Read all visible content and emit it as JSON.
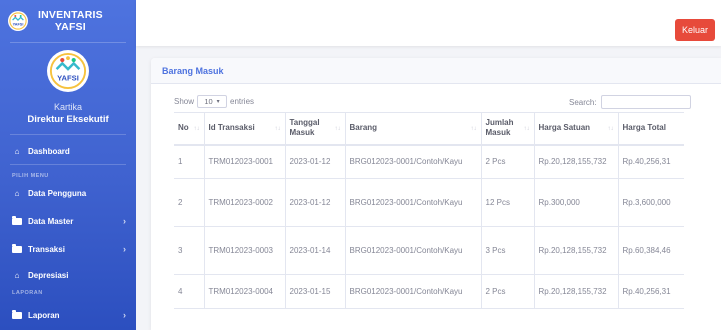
{
  "brand": {
    "line1": "INVENTARIS",
    "line2": "YAFSI",
    "logo_text": "YAFSI"
  },
  "profile": {
    "logo_text": "YAFSI",
    "name": "Kartika",
    "role": "Direktur Eksekutif"
  },
  "nav": {
    "dashboard": "Dashboard",
    "heading_menu": "PILIH MENU",
    "data_pengguna": "Data Pengguna",
    "data_master": "Data Master",
    "transaksi": "Transaksi",
    "depresiasi": "Depresiasi",
    "heading_laporan": "LAPORAN",
    "laporan": "Laporan"
  },
  "topbar": {
    "logout_label": "Keluar"
  },
  "card": {
    "title": "Barang Masuk"
  },
  "controls": {
    "show_label": "Show",
    "entries_value": "10",
    "entries_label": "entries",
    "search_label": "Search:"
  },
  "table": {
    "headers": [
      "No",
      "Id Transaksi",
      "Tanggal Masuk",
      "Barang",
      "Jumlah Masuk",
      "Harga Satuan",
      "Harga Total"
    ],
    "rows": [
      [
        "1",
        "TRM012023-0001",
        "2023-01-12",
        "BRG012023-0001/Contoh/Kayu",
        "2 Pcs",
        "Rp.20,128,155,732",
        "Rp.40,256,31"
      ],
      [
        "2",
        "TRM012023-0002",
        "2023-01-12",
        "BRG012023-0001/Contoh/Kayu",
        "12 Pcs",
        "Rp.300,000",
        "Rp.3,600,000"
      ],
      [
        "3",
        "TRM012023-0003",
        "2023-01-14",
        "BRG012023-0001/Contoh/Kayu",
        "3 Pcs",
        "Rp.20,128,155,732",
        "Rp.60,384,46"
      ],
      [
        "4",
        "TRM012023-0004",
        "2023-01-15",
        "BRG012023-0001/Contoh/Kayu",
        "2 Pcs",
        "Rp.20,128,155,732",
        "Rp.40,256,31"
      ]
    ]
  },
  "colors": {
    "sidebar": "#4e73df",
    "logout": "#e74a3b",
    "accent_text": "#4e73df"
  }
}
